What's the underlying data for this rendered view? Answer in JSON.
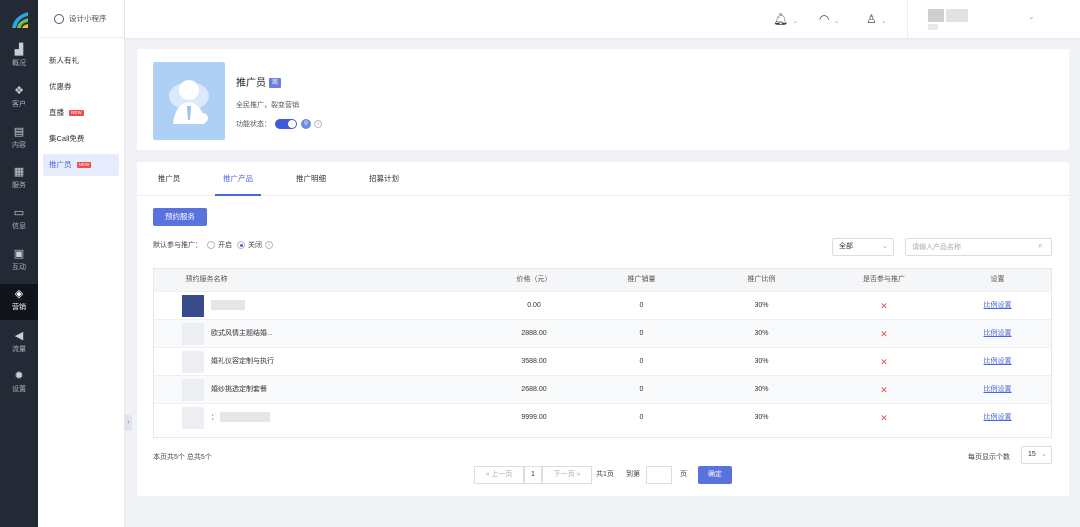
{
  "colors": {
    "accent": "#4b66dd",
    "sidebar_bg": "#232a36",
    "danger": "#e34d4d"
  },
  "sidebar": {
    "items": [
      {
        "label": "概况",
        "icon": "chart-icon"
      },
      {
        "label": "客户",
        "icon": "users-icon"
      },
      {
        "label": "内容",
        "icon": "document-icon"
      },
      {
        "label": "服务",
        "icon": "service-icon"
      },
      {
        "label": "信息",
        "icon": "message-icon"
      },
      {
        "label": "互动",
        "icon": "interact-icon"
      },
      {
        "label": "营销",
        "icon": "tag-icon"
      },
      {
        "label": "流量",
        "icon": "megaphone-icon"
      },
      {
        "label": "设置",
        "icon": "gear-icon"
      }
    ]
  },
  "subnav": {
    "header": "设计小程序",
    "items": [
      {
        "label": "新人有礼",
        "badge": ""
      },
      {
        "label": "优惠券",
        "badge": ""
      },
      {
        "label": "直播",
        "badge": "NEW"
      },
      {
        "label": "集Call免费",
        "badge": ""
      },
      {
        "label": "推广员",
        "badge": "NEW"
      }
    ]
  },
  "profile": {
    "title": "推广员",
    "badge": "商",
    "desc": "全民推广，裂变营销",
    "status_label": "功能状态："
  },
  "tabs": [
    "推广员",
    "推广产品",
    "推广明细",
    "招募计划"
  ],
  "actions": {
    "book_service": "预约服务"
  },
  "filter": {
    "label": "默认参与推广：",
    "option_on": "开启",
    "option_off": "关闭",
    "select_value": "全部",
    "search_placeholder": "请输入产品名称"
  },
  "table": {
    "headers": [
      "预约服务名称",
      "价格（元）",
      "推广销量",
      "推广比例",
      "是否参与推广",
      "设置"
    ],
    "rows": [
      {
        "name": "",
        "price": "0.00",
        "sales": "0",
        "ratio": "30%",
        "participate": "✕",
        "action": "比例设置"
      },
      {
        "name": "欧式风情主题结婚...",
        "price": "2888.00",
        "sales": "0",
        "ratio": "30%",
        "participate": "✕",
        "action": "比例设置"
      },
      {
        "name": "婚礼仪容定制与执行",
        "price": "3588.00",
        "sales": "0",
        "ratio": "30%",
        "participate": "✕",
        "action": "比例设置"
      },
      {
        "name": "婚纱挑选定制套餐",
        "price": "2688.00",
        "sales": "0",
        "ratio": "30%",
        "participate": "✕",
        "action": "比例设置"
      },
      {
        "name": "：",
        "price": "9999.00",
        "sales": "0",
        "ratio": "30%",
        "participate": "✕",
        "action": "比例设置"
      }
    ]
  },
  "footer": {
    "summary": "本页共5个   总共5个",
    "page_size_label": "每页显示个数",
    "page_size": "15",
    "prev": "« 上一页",
    "page": "1",
    "next": "下一页 »",
    "total_pages": "共1页",
    "goto": "到第",
    "page_unit": "页",
    "confirm": "确定"
  }
}
